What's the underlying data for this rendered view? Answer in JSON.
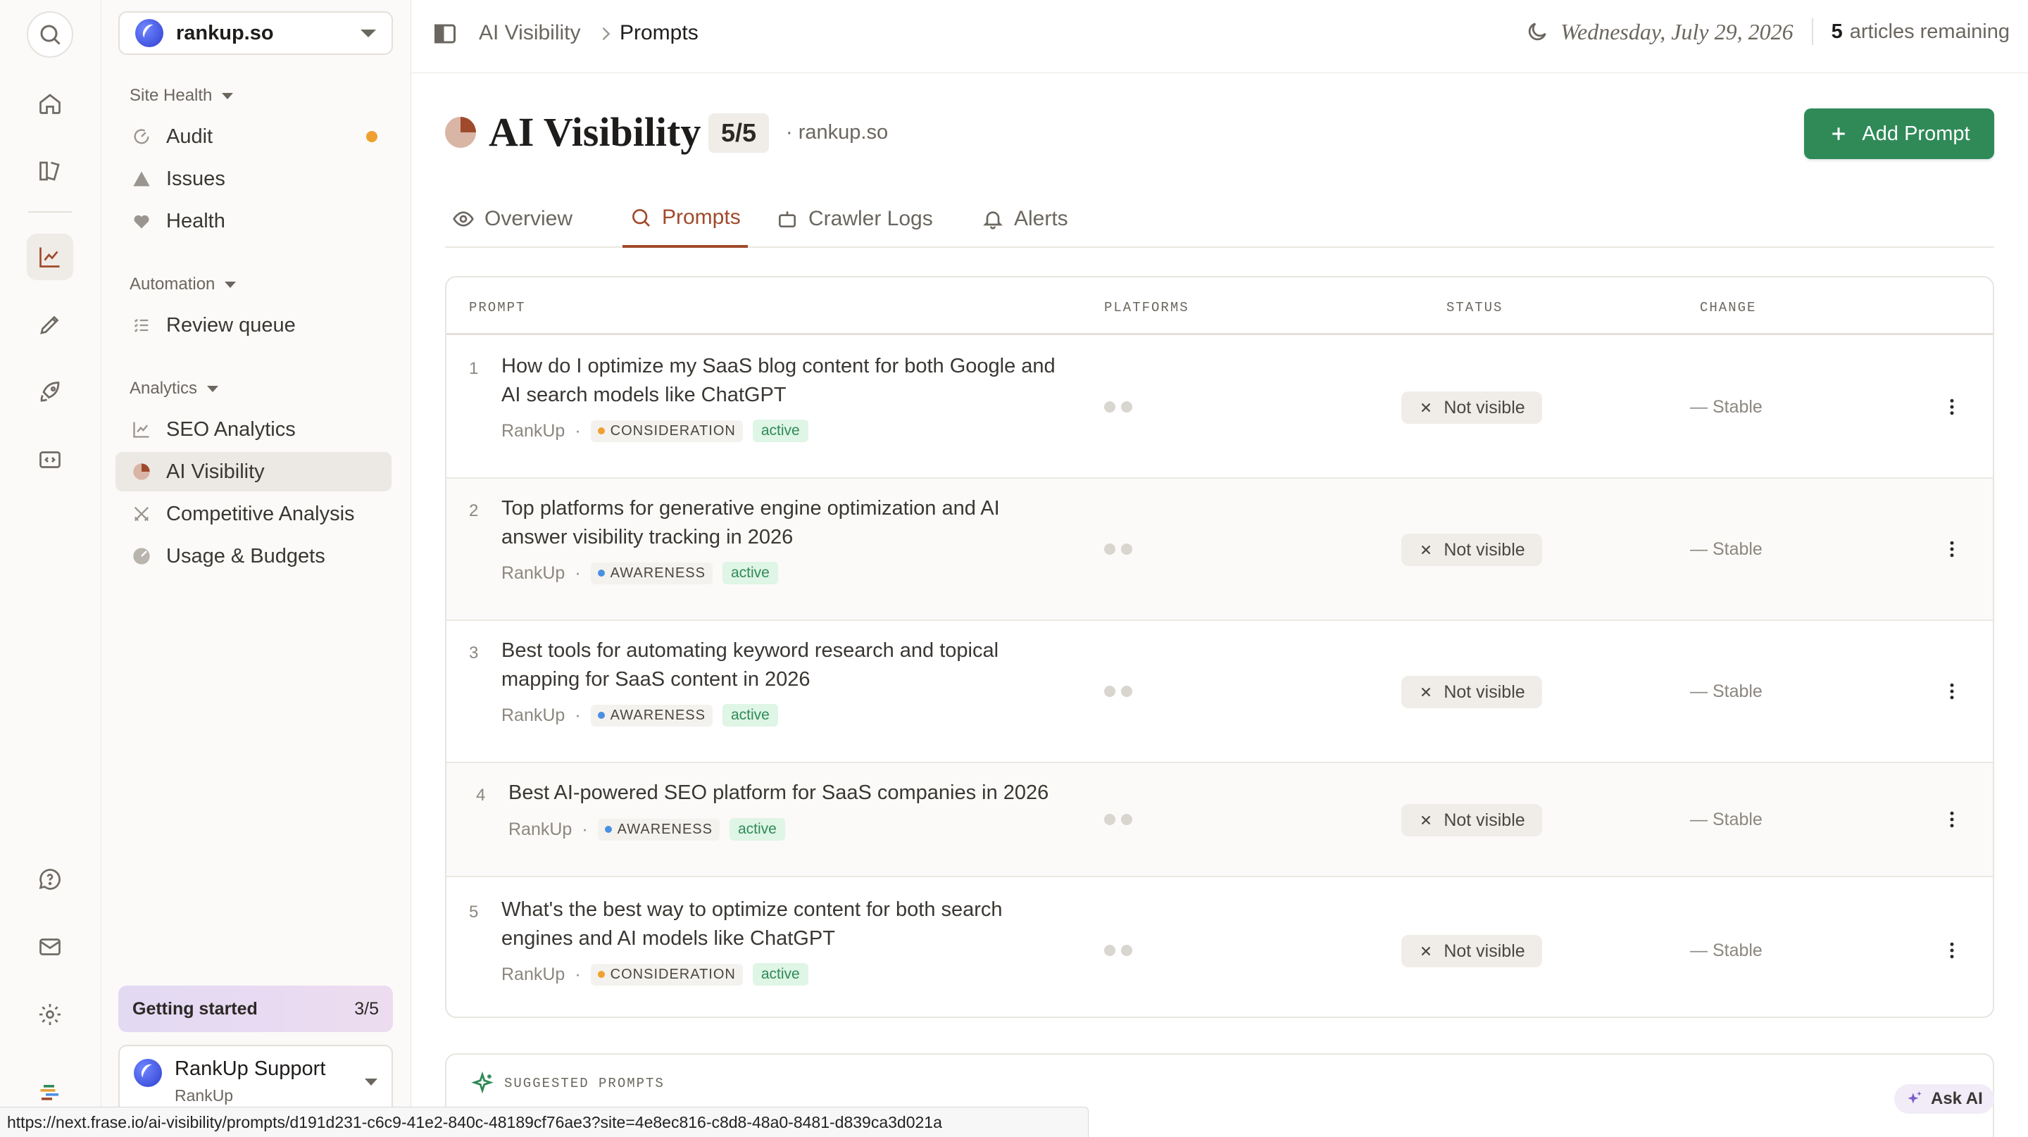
{
  "rail": {
    "top_icons": [
      "search-icon",
      "home-icon",
      "library-icon",
      "analytics-icon",
      "pen-icon",
      "rocket-icon",
      "code-icon"
    ],
    "bottom_icons": [
      "help-icon",
      "mail-icon",
      "settings-icon",
      "logo-icon"
    ],
    "active": "analytics-icon"
  },
  "sidebar": {
    "site": "rankup.so",
    "sections": [
      {
        "label": "Site Health",
        "items": [
          {
            "label": "Audit",
            "icon": "gauge-icon",
            "indicator": true
          },
          {
            "label": "Issues",
            "icon": "warning-icon"
          },
          {
            "label": "Health",
            "icon": "heartbeat-icon"
          }
        ]
      },
      {
        "label": "Automation",
        "items": [
          {
            "label": "Review queue",
            "icon": "checklist-icon"
          }
        ]
      },
      {
        "label": "Analytics",
        "items": [
          {
            "label": "SEO Analytics",
            "icon": "line-chart-icon"
          },
          {
            "label": "AI Visibility",
            "icon": "pie-icon",
            "active": true
          },
          {
            "label": "Competitive Analysis",
            "icon": "swords-icon"
          },
          {
            "label": "Usage & Budgets",
            "icon": "budget-icon"
          }
        ]
      }
    ],
    "getting_started": {
      "label": "Getting started",
      "progress": "3/5"
    },
    "account": {
      "name": "RankUp Support",
      "org": "RankUp"
    }
  },
  "topbar": {
    "breadcrumb": [
      "AI Visibility",
      "Prompts"
    ],
    "date": "Wednesday, July 29, 2026",
    "articles_count": "5",
    "articles_label": "articles remaining"
  },
  "header": {
    "title": "AI Visibility",
    "count": "5/5",
    "site": "· rankup.so",
    "add_button": "Add Prompt"
  },
  "tabs": [
    {
      "label": "Overview",
      "icon": "eye-icon"
    },
    {
      "label": "Prompts",
      "icon": "search-icon",
      "active": true
    },
    {
      "label": "Crawler Logs",
      "icon": "robot-icon"
    },
    {
      "label": "Alerts",
      "icon": "bell-icon"
    }
  ],
  "table": {
    "columns": [
      "PROMPT",
      "PLATFORMS",
      "STATUS",
      "CHANGE"
    ],
    "rows": [
      {
        "num": "1",
        "line1": "How do I optimize my SaaS blog content for both Google and",
        "line2": "AI search models like ChatGPT",
        "brand": "RankUp",
        "stage": "CONSIDERATION",
        "stage_color": "#f0a030",
        "state": "active",
        "status": "Not visible",
        "change": "— Stable"
      },
      {
        "num": "2",
        "line1": "Top platforms for generative engine optimization and AI",
        "line2": "answer visibility tracking in 2026",
        "brand": "RankUp",
        "stage": "AWARENESS",
        "stage_color": "#4a90e2",
        "state": "active",
        "status": "Not visible",
        "change": "— Stable"
      },
      {
        "num": "3",
        "line1": "Best tools for automating keyword research and topical",
        "line2": "mapping for SaaS content in 2026",
        "brand": "RankUp",
        "stage": "AWARENESS",
        "stage_color": "#4a90e2",
        "state": "active",
        "status": "Not visible",
        "change": "— Stable"
      },
      {
        "num": "4",
        "line1": "Best AI-powered SEO platform for SaaS companies in 2026",
        "line2": "",
        "brand": "RankUp",
        "stage": "AWARENESS",
        "stage_color": "#4a90e2",
        "state": "active",
        "status": "Not visible",
        "change": "— Stable"
      },
      {
        "num": "5",
        "line1": "What's the best way to optimize content for both search",
        "line2": "engines and AI models like ChatGPT",
        "brand": "RankUp",
        "stage": "CONSIDERATION",
        "stage_color": "#f0a030",
        "state": "active",
        "status": "Not visible",
        "change": "— Stable"
      }
    ]
  },
  "suggested": {
    "label": "SUGGESTED PROMPTS"
  },
  "ask_ai": "Ask AI",
  "status_url": "https://next.frase.io/ai-visibility/prompts/d191d231-c6c9-41e2-840c-48189cf76ae3?site=4e8ec816-c8d8-48a0-8481-d839ca3d021a",
  "colors": {
    "accent": "#a04a2c",
    "primary_button": "#2f8a58",
    "active_pill_bg": "#dff5e5"
  }
}
